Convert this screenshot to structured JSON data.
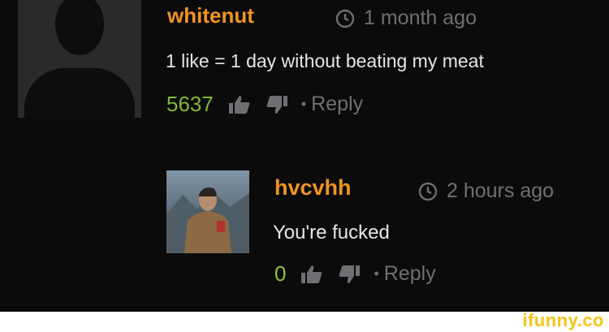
{
  "comments": [
    {
      "username": "whitenut",
      "time": "1 month ago",
      "text": "1 like = 1 day without beating my meat",
      "likes": "5637",
      "separator": "•",
      "reply_label": "Reply",
      "avatar": "default-user-silhouette"
    },
    {
      "username": "hvcvhh",
      "time": "2 hours ago",
      "text": "You're fucked",
      "likes": "0",
      "separator": "•",
      "reply_label": "Reply",
      "avatar": "user-photo"
    }
  ],
  "watermark": {
    "text": "ifunny.co"
  },
  "colors": {
    "background": "#0b0b0c",
    "username": "#f19322",
    "like_count": "#86b638",
    "muted": "#6f6f73",
    "text": "#e6e6e6",
    "watermark": "#f6c514"
  },
  "icons": [
    "clock-icon",
    "thumbs-up-icon",
    "thumbs-down-icon"
  ]
}
